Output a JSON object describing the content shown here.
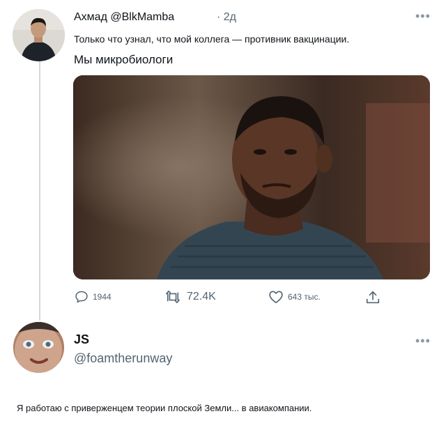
{
  "tweet1": {
    "author_line": "Ахмад @BlkMamba",
    "time": "· 2д",
    "text_line1": "Только что узнал, что мой коллега — противник вакцинации.",
    "text_line2": "Мы микробиологи",
    "more": "•••",
    "stats": {
      "replies": "1944",
      "retweets": "72.4K",
      "likes": "643 тыс."
    },
    "icons": {
      "reply": "reply-icon",
      "retweet": "retweet-icon",
      "like": "heart-icon",
      "share": "share-icon"
    }
  },
  "tweet2": {
    "name": "JS",
    "handle": "@foamtherunway",
    "more": "•••",
    "text": "Я работаю с приверженцем теории плоской Земли... в авиакомпании."
  },
  "colors": {
    "text": "#0f1419",
    "secondary": "#536471",
    "thread_line": "#cfd9de"
  }
}
